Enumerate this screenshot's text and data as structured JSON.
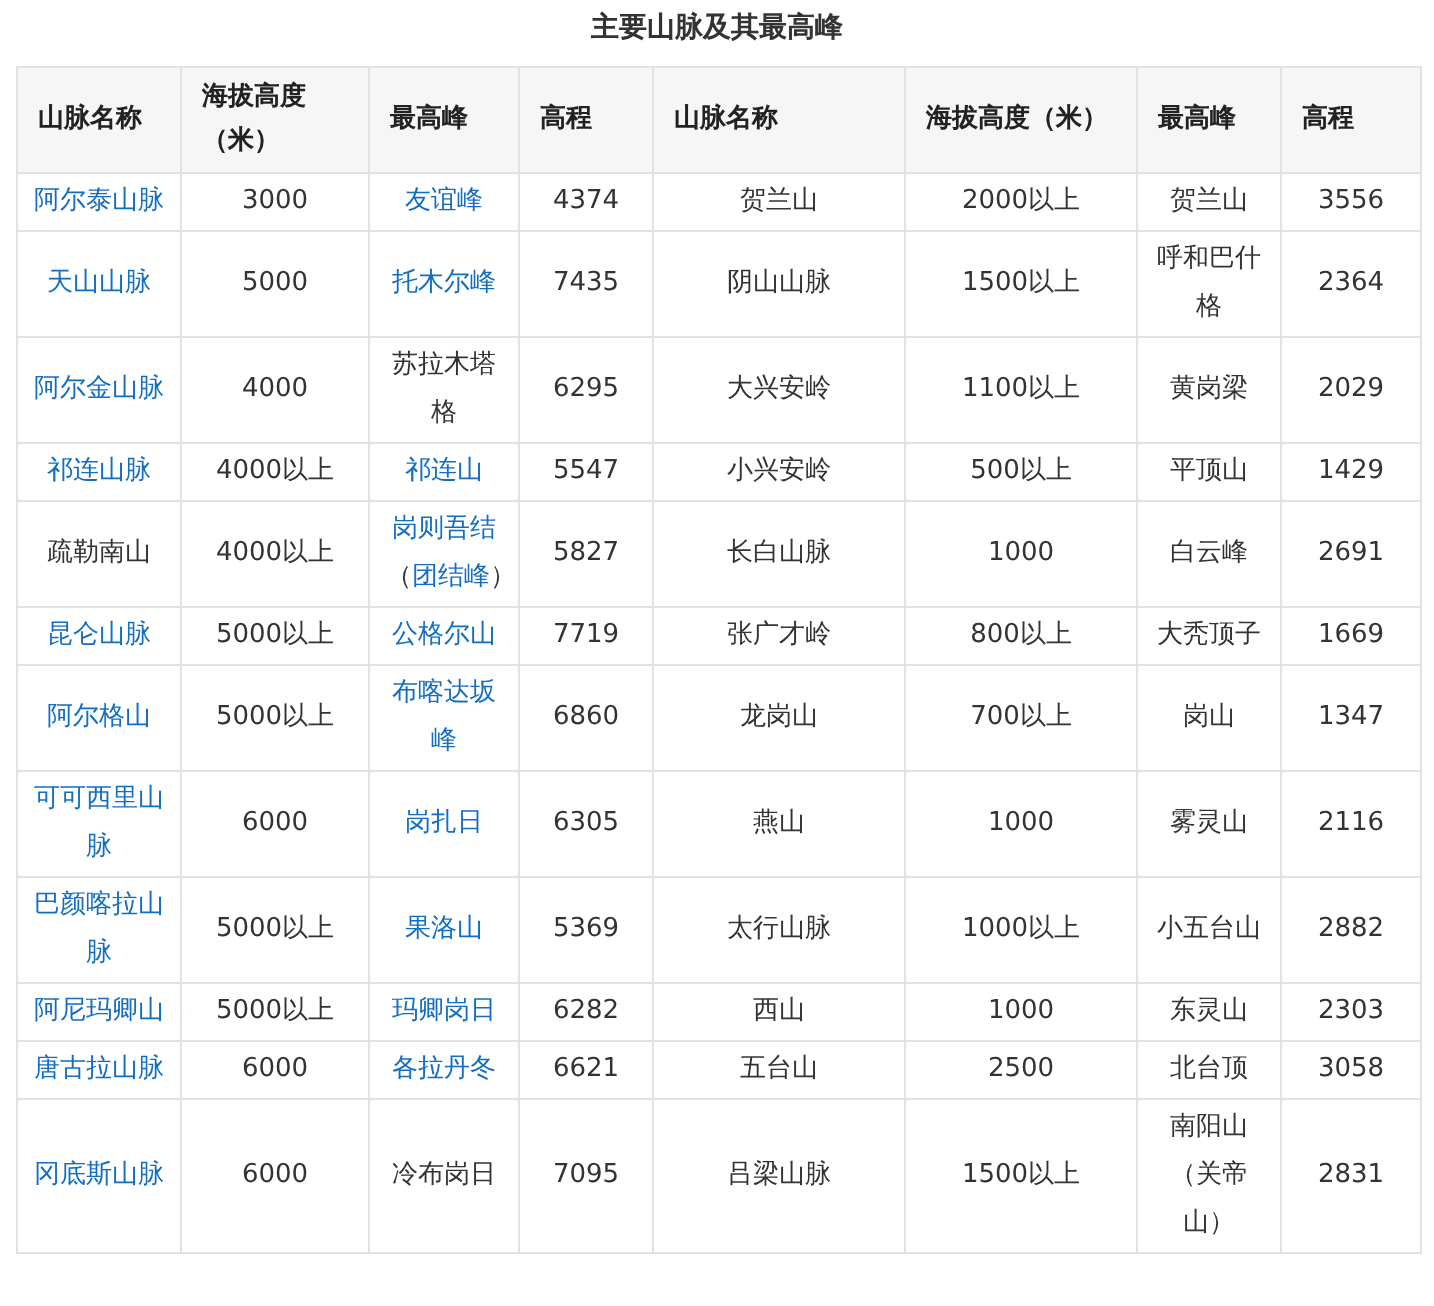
{
  "title": "主要山脉及其最高峰",
  "table": {
    "columns": [
      "山脉名称",
      "海拔高度（米）",
      "最高峰",
      "高程",
      "山脉名称",
      "海拔高度（米）",
      "最高峰",
      "高程"
    ],
    "rows": [
      [
        {
          "text": "阿尔泰山脉",
          "link": true
        },
        {
          "text": "3000",
          "link": false
        },
        {
          "text": "友谊峰",
          "link": true
        },
        {
          "text": "4374",
          "link": false
        },
        {
          "text": "贺兰山",
          "link": false
        },
        {
          "text": "2000以上",
          "link": false
        },
        {
          "text": "贺兰山",
          "link": false
        },
        {
          "text": "3556",
          "link": false
        }
      ],
      [
        {
          "text": "天山山脉",
          "link": true
        },
        {
          "text": "5000",
          "link": false
        },
        {
          "text": "托木尔峰",
          "link": true
        },
        {
          "text": "7435",
          "link": false
        },
        {
          "text": "阴山山脉",
          "link": false
        },
        {
          "text": "1500以上",
          "link": false
        },
        {
          "text": "呼和巴什格",
          "link": false
        },
        {
          "text": "2364",
          "link": false
        }
      ],
      [
        {
          "text": "阿尔金山脉",
          "link": true
        },
        {
          "text": "4000",
          "link": false
        },
        {
          "text": "苏拉木塔格",
          "link": false
        },
        {
          "text": "6295",
          "link": false
        },
        {
          "text": "大兴安岭",
          "link": false
        },
        {
          "text": "1100以上",
          "link": false
        },
        {
          "text": "黄岗梁",
          "link": false
        },
        {
          "text": "2029",
          "link": false
        }
      ],
      [
        {
          "text": "祁连山脉",
          "link": true
        },
        {
          "text": "4000以上",
          "link": false
        },
        {
          "text": "祁连山",
          "link": true
        },
        {
          "text": "5547",
          "link": false
        },
        {
          "text": "小兴安岭",
          "link": false
        },
        {
          "text": "500以上",
          "link": false
        },
        {
          "text": "平顶山",
          "link": false
        },
        {
          "text": "1429",
          "link": false
        }
      ],
      [
        {
          "text": "疏勒南山",
          "link": false
        },
        {
          "text": "4000以上",
          "link": false
        },
        {
          "parts": [
            {
              "text": "岗则吾结",
              "link": true
            },
            {
              "text": "（",
              "link": false
            },
            {
              "text": "团结峰",
              "link": true
            },
            {
              "text": "）",
              "link": false
            }
          ]
        },
        {
          "text": "5827",
          "link": false
        },
        {
          "text": "长白山脉",
          "link": false
        },
        {
          "text": "1000",
          "link": false
        },
        {
          "text": "白云峰",
          "link": false
        },
        {
          "text": "2691",
          "link": false
        }
      ],
      [
        {
          "text": "昆仑山脉",
          "link": true
        },
        {
          "text": "5000以上",
          "link": false
        },
        {
          "text": "公格尔山",
          "link": true
        },
        {
          "text": "7719",
          "link": false
        },
        {
          "text": "张广才岭",
          "link": false
        },
        {
          "text": "800以上",
          "link": false
        },
        {
          "text": "大秃顶子",
          "link": false
        },
        {
          "text": "1669",
          "link": false
        }
      ],
      [
        {
          "text": "阿尔格山",
          "link": true
        },
        {
          "text": "5000以上",
          "link": false
        },
        {
          "text": "布喀达坂峰",
          "link": true
        },
        {
          "text": "6860",
          "link": false
        },
        {
          "text": "龙岗山",
          "link": false
        },
        {
          "text": "700以上",
          "link": false
        },
        {
          "text": "岗山",
          "link": false
        },
        {
          "text": "1347",
          "link": false
        }
      ],
      [
        {
          "text": "可可西里山脉",
          "link": true
        },
        {
          "text": "6000",
          "link": false
        },
        {
          "text": "岗扎日",
          "link": true
        },
        {
          "text": "6305",
          "link": false
        },
        {
          "text": "燕山",
          "link": false
        },
        {
          "text": "1000",
          "link": false
        },
        {
          "text": "雾灵山",
          "link": false
        },
        {
          "text": "2116",
          "link": false
        }
      ],
      [
        {
          "text": "巴颜喀拉山脉",
          "link": true
        },
        {
          "text": "5000以上",
          "link": false
        },
        {
          "text": "果洛山",
          "link": true
        },
        {
          "text": "5369",
          "link": false
        },
        {
          "text": "太行山脉",
          "link": false
        },
        {
          "text": "1000以上",
          "link": false
        },
        {
          "text": "小五台山",
          "link": false
        },
        {
          "text": "2882",
          "link": false
        }
      ],
      [
        {
          "text": "阿尼玛卿山",
          "link": true
        },
        {
          "text": "5000以上",
          "link": false
        },
        {
          "text": "玛卿岗日",
          "link": true
        },
        {
          "text": "6282",
          "link": false
        },
        {
          "text": "西山",
          "link": false
        },
        {
          "text": "1000",
          "link": false
        },
        {
          "text": "东灵山",
          "link": false
        },
        {
          "text": "2303",
          "link": false
        }
      ],
      [
        {
          "text": "唐古拉山脉",
          "link": true
        },
        {
          "text": "6000",
          "link": false
        },
        {
          "text": "各拉丹冬",
          "link": true
        },
        {
          "text": "6621",
          "link": false
        },
        {
          "text": "五台山",
          "link": false
        },
        {
          "text": "2500",
          "link": false
        },
        {
          "text": "北台顶",
          "link": false
        },
        {
          "text": "3058",
          "link": false
        }
      ],
      [
        {
          "text": "冈底斯山脉",
          "link": true
        },
        {
          "text": "6000",
          "link": false
        },
        {
          "text": "冷布岗日",
          "link": false
        },
        {
          "text": "7095",
          "link": false
        },
        {
          "text": "吕梁山脉",
          "link": false
        },
        {
          "text": "1500以上",
          "link": false
        },
        {
          "text": "南阳山（关帝山）",
          "link": false
        },
        {
          "text": "2831",
          "link": false
        }
      ]
    ]
  }
}
